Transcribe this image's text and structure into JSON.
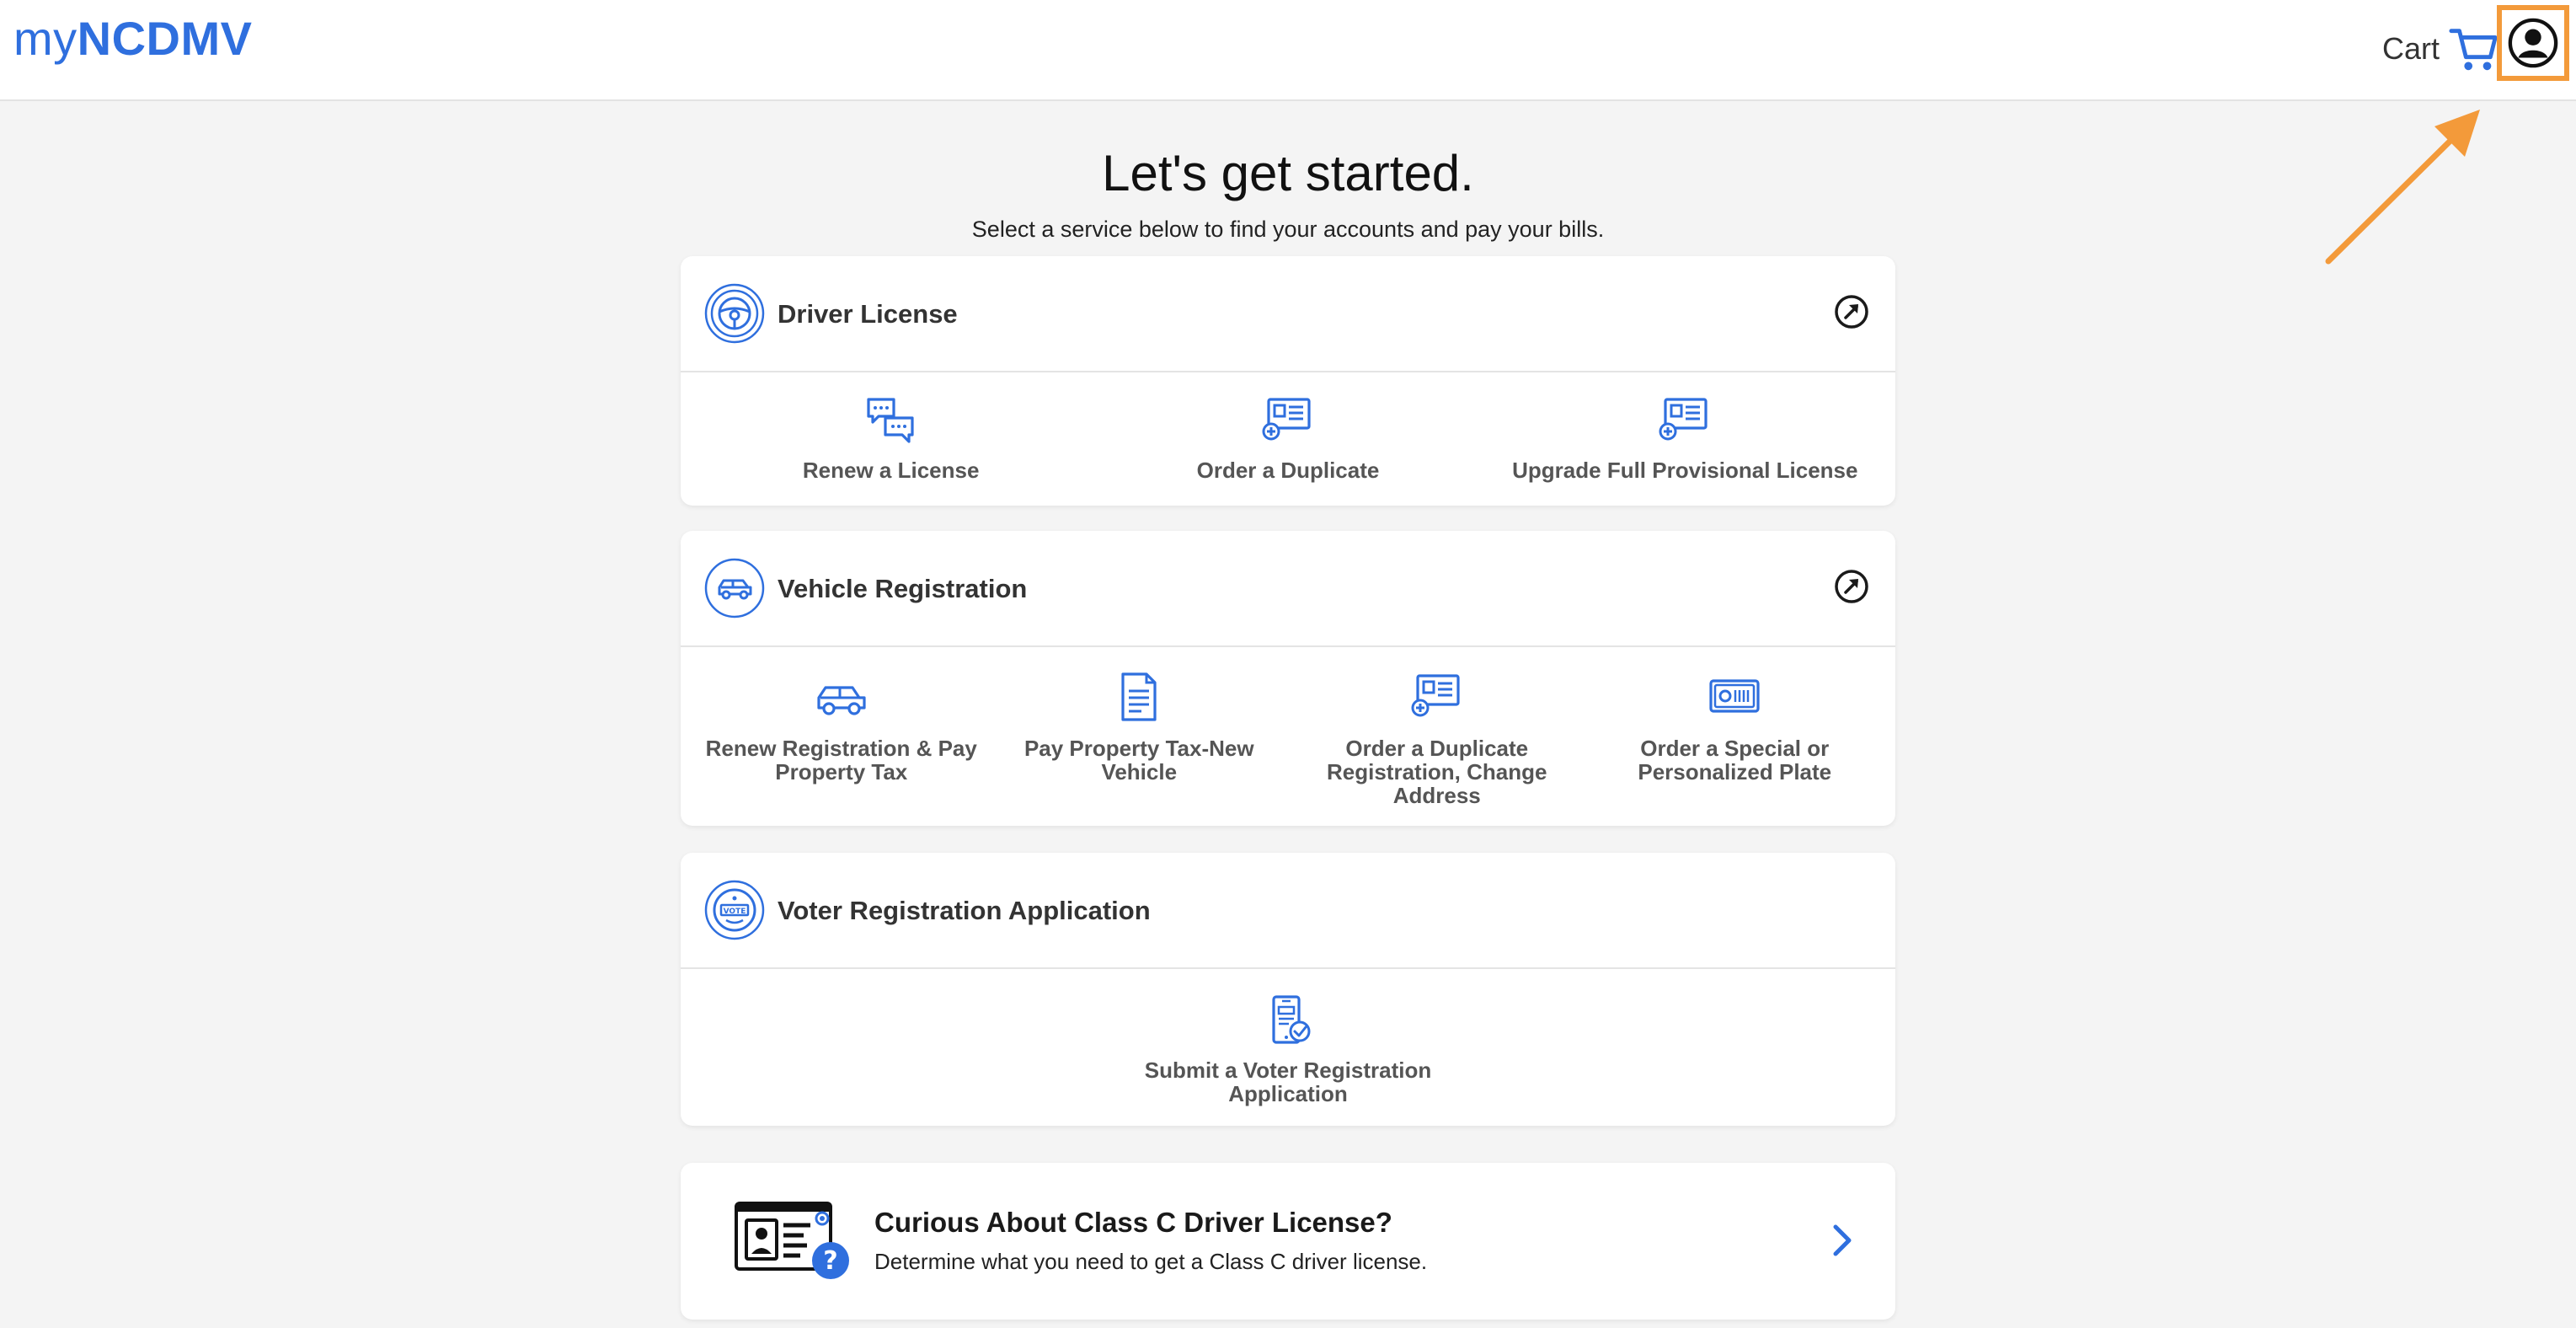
{
  "header": {
    "logo_prefix": "my",
    "logo_brand": "NCDMV",
    "cart_label": "Cart",
    "cart_icon": "shopping-cart-icon",
    "account_icon": "user-account-icon"
  },
  "intro": {
    "title": "Let's get started.",
    "subtitle": "Select a service below to find your accounts and pay your bills."
  },
  "sections": {
    "driver": {
      "title": "Driver License",
      "icon": "steering-wheel-icon",
      "services": [
        {
          "label": "Renew a License",
          "icon": "chat-bubbles-icon"
        },
        {
          "label": "Order a Duplicate",
          "icon": "id-card-plus-icon"
        },
        {
          "label": "Upgrade Full Provisional License",
          "icon": "id-card-plus-icon"
        }
      ]
    },
    "vehicle": {
      "title": "Vehicle Registration",
      "icon": "car-icon",
      "services": [
        {
          "label": "Renew Registration & Pay Property Tax",
          "icon": "car-icon"
        },
        {
          "label": "Pay Property Tax-New Vehicle",
          "icon": "document-icon"
        },
        {
          "label": "Order a Duplicate Registration, Change Address",
          "icon": "id-card-plus-icon"
        },
        {
          "label": "Order a Special or Personalized Plate",
          "icon": "license-plate-icon"
        }
      ]
    },
    "voter": {
      "title": "Voter Registration Application",
      "icon": "vote-badge-icon",
      "services": [
        {
          "label": "Submit a Voter Registration Application",
          "icon": "mobile-check-icon"
        }
      ]
    }
  },
  "promo": {
    "title": "Curious About Class C Driver License?",
    "subtitle": "Determine what you need to get a Class C driver license.",
    "icon": "license-question-icon"
  },
  "colors": {
    "brand_blue": "#2f6fde",
    "highlight_orange": "#f39a3a",
    "background": "#f4f4f4"
  }
}
